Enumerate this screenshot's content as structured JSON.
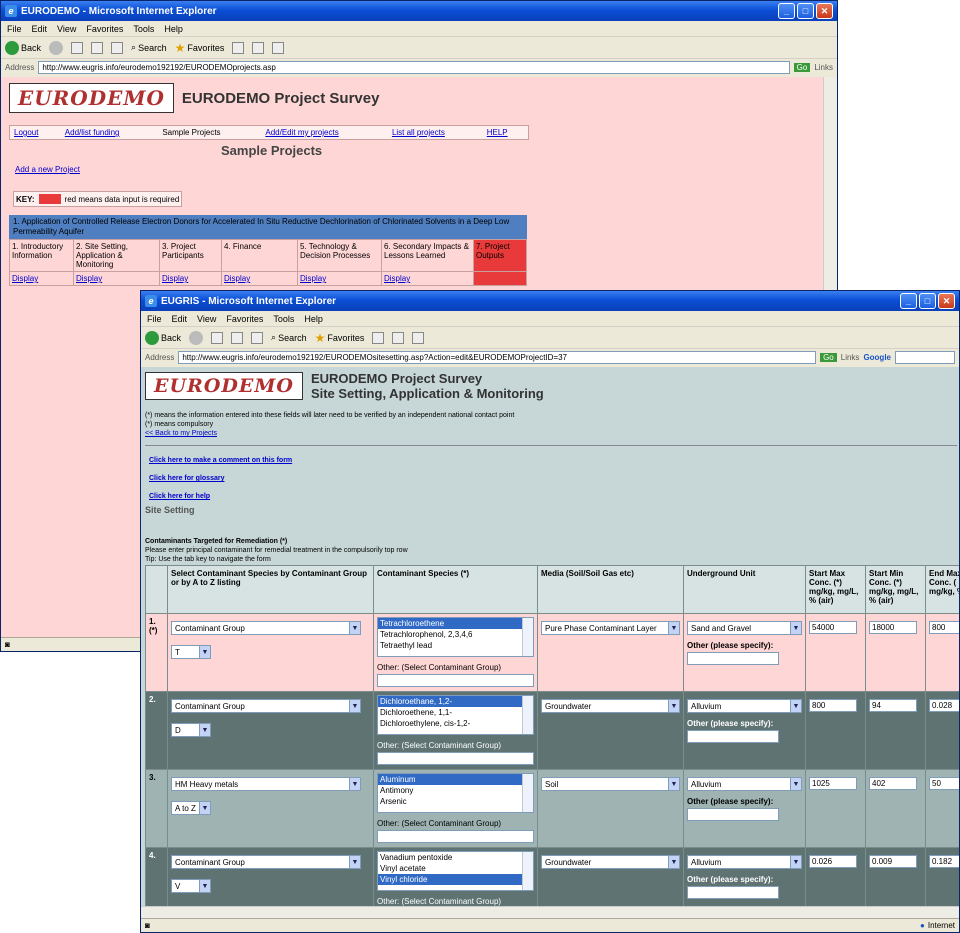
{
  "win1": {
    "title": "EURODEMO - Microsoft Internet Explorer",
    "menu": [
      "File",
      "Edit",
      "View",
      "Favorites",
      "Tools",
      "Help"
    ],
    "toolbar": {
      "back": "Back",
      "search": "Search",
      "favorites": "Favorites"
    },
    "address_label": "Address",
    "address": "http://www.eugris.info/eurodemo192192/EURODEMOprojects.asp",
    "go": "Go",
    "links": "Links",
    "page": {
      "logo": "EURODEMO",
      "heading": "EURODEMO Project Survey",
      "nav": [
        "Logout",
        "Add/list funding",
        "Sample Projects",
        "Add/Edit my projects",
        "List all projects",
        "HELP"
      ],
      "section_title": "Sample Projects",
      "add_link": "Add a new Project",
      "key_label": "KEY:",
      "key_text": "red means data input is required",
      "project_title": "1. Application of Controlled Release Electron Donors for Accelerated In Situ Reductive Dechlorination of Chlorinated Solvents in a Deep Low Permeability Aquifer",
      "phases": [
        "1. Introductory Information",
        "2. Site Setting, Application & Monitoring",
        "3. Project Participants",
        "4. Finance",
        "5. Technology & Decision Processes",
        "6. Secondary Impacts & Lessons Learned",
        "7. Project Outputs"
      ],
      "display": "Display"
    }
  },
  "win2": {
    "title": "EUGRIS - Microsoft Internet Explorer",
    "menu": [
      "File",
      "Edit",
      "View",
      "Favorites",
      "Tools",
      "Help"
    ],
    "toolbar": {
      "back": "Back",
      "search": "Search",
      "favorites": "Favorites"
    },
    "address_label": "Address",
    "address": "http://www.eugris.info/eurodemo192192/EURODEMOsitesetting.asp?Action=edit&EURODEMOProjectID=37",
    "go": "Go",
    "links": "Links",
    "google": "Google",
    "status": "Internet",
    "page": {
      "logo": "EURODEMO",
      "heading1": "EURODEMO Project Survey",
      "heading2": "Site Setting, Application & Monitoring",
      "note1": "(*) means the information entered into these fields will later need to be verified by an independent national contact point",
      "note2": "(*) means compulsory",
      "back_link": "<< Back to my Projects",
      "comment_link": "Click here to make a comment on this form",
      "glossary_link": "Click here for glossary",
      "help_link": "Click here for help",
      "section": "Site Setting",
      "cont_title": "Contaminants Targeted for Remediation (*)",
      "cont_desc": "Please enter principal contaminant for remedial treatment in the compulsorily top row",
      "tip": "Tip: Use the tab key to navigate the form",
      "headers": [
        "Select Contaminant Species by Contaminant Group or by A to Z listing",
        "Contaminant Species (*)",
        "Media (Soil/Soil Gas etc)",
        "Underground Unit",
        "Start Max Conc. (*) mg/kg, mg/L, % (air)",
        "Start Min Conc. (*) mg/kg, mg/L, % (air)",
        "End Max Conc. ( mg/kg, % (air)"
      ],
      "other_species": "Other: (Select Contaminant Group)",
      "other_specify": "Other (please specify):",
      "rows": [
        {
          "num": "1. (*)",
          "group": "Contaminant Group",
          "letter": "T",
          "species": [
            "Tetrachloroethene",
            "Tetrachlorophenol, 2,3,4,6",
            "Tetraethyl lead"
          ],
          "sel": 0,
          "media": "Pure Phase Contaminant Layer",
          "unit": "Sand and Gravel",
          "smax": "54000",
          "smin": "18000",
          "emax": "800"
        },
        {
          "num": "2.",
          "group": "Contaminant Group",
          "letter": "D",
          "species": [
            "Dichloroethane, 1,2-",
            "Dichloroethene, 1,1-",
            "Dichloroethylene, cis-1,2-"
          ],
          "sel": 0,
          "media": "Groundwater",
          "unit": "Alluvium",
          "smax": "800",
          "smin": "94",
          "emax": "0.028"
        },
        {
          "num": "3.",
          "group": "HM Heavy metals",
          "letter": "A to Z",
          "species": [
            "Aluminum",
            "Antimony",
            "Arsenic"
          ],
          "sel": 0,
          "media": "Soil",
          "unit": "Alluvium",
          "smax": "1025",
          "smin": "402",
          "emax": "50"
        },
        {
          "num": "4.",
          "group": "Contaminant Group",
          "letter": "V",
          "species": [
            "Vanadium pentoxide",
            "Vinyl acetate",
            "Vinyl chloride"
          ],
          "sel": 2,
          "media": "Groundwater",
          "unit": "Alluvium",
          "smax": "0.026",
          "smin": "0.009",
          "emax": "0.182"
        }
      ]
    }
  }
}
